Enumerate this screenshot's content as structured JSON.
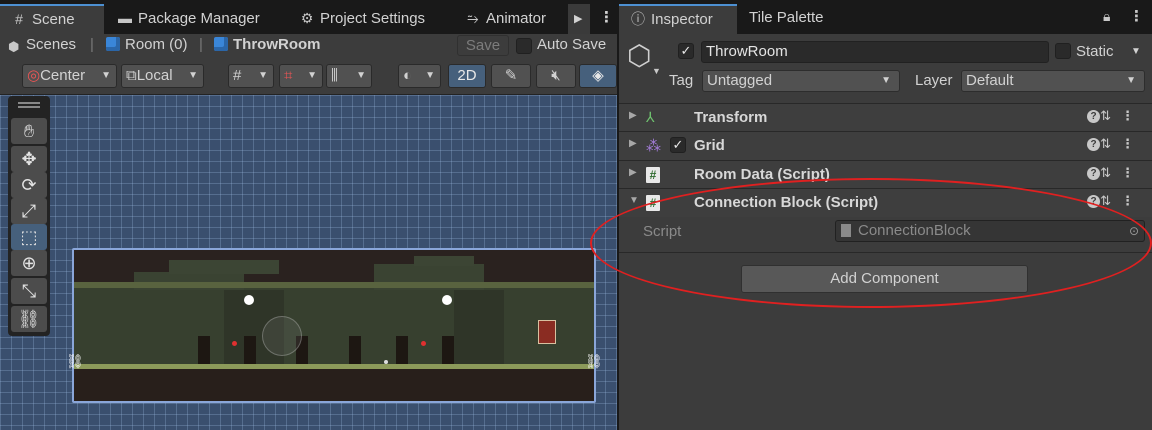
{
  "tabs_left": [
    {
      "label": "Scene",
      "icon": "hash-grid-icon"
    },
    {
      "label": "Package Manager",
      "icon": "package-icon"
    },
    {
      "label": "Project Settings",
      "icon": "gear-icon"
    },
    {
      "label": "Animator",
      "icon": "animator-icon"
    }
  ],
  "breadcrumb": {
    "root": "Scenes",
    "items": [
      "Room (0)",
      "ThrowRoom"
    ]
  },
  "scene_header": {
    "save_label": "Save",
    "auto_save_label": "Auto Save"
  },
  "scene_toolbar": {
    "pivot_label": "Center",
    "space_label": "Local",
    "mode_2d_label": "2D"
  },
  "tools": [
    "hand-tool",
    "move-tool",
    "rotate-tool",
    "scale-tool",
    "rect-tool",
    "transform-tool",
    "custom-tool",
    "link-tool"
  ],
  "tabs_right": [
    {
      "label": "Inspector",
      "icon": "info-icon"
    },
    {
      "label": "Tile Palette",
      "icon": ""
    }
  ],
  "inspector": {
    "object_name": "ThrowRoom",
    "static_label": "Static",
    "tag_label": "Tag",
    "tag_value": "Untagged",
    "layer_label": "Layer",
    "layer_value": "Default",
    "components": [
      {
        "name": "Transform",
        "expanded": false
      },
      {
        "name": "Grid",
        "expanded": false,
        "enabled": true
      },
      {
        "name": "Room Data (Script)",
        "expanded": false
      },
      {
        "name": "Connection Block (Script)",
        "expanded": true
      }
    ],
    "script_field_label": "Script",
    "script_value": "ConnectionBlock",
    "add_component_label": "Add Component"
  },
  "colors": {
    "accent": "#4d90d2",
    "annotation": "#e02020"
  }
}
